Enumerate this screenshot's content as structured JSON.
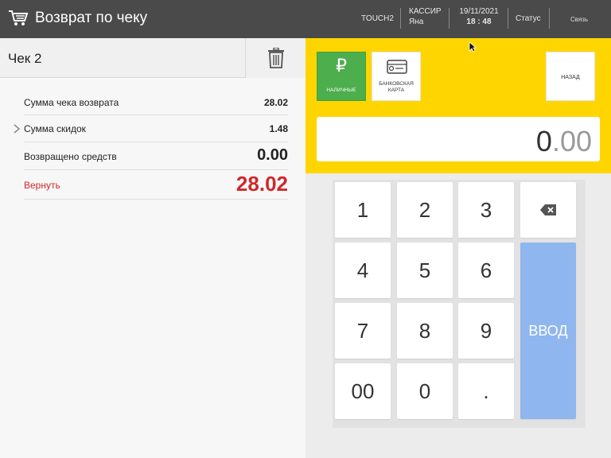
{
  "header": {
    "title": "Возврат по чеку",
    "terminal": "TOUCH2",
    "cashier_label": "КАССИР",
    "cashier_name": "Яна",
    "date": "19/11/2021",
    "time": "18 : 48",
    "status": "Статус",
    "link": "Связь"
  },
  "receipt": {
    "title": "Чек 2",
    "rows": [
      {
        "label": "Сумма чека возврата",
        "value": "28.02"
      },
      {
        "label": "Сумма скидок",
        "value": "1.48"
      },
      {
        "label": "Возвращено средств",
        "value": "0.00"
      },
      {
        "label": "Вернуть",
        "value": "28.02"
      }
    ]
  },
  "payment": {
    "cash_symbol": "₽",
    "cash_label": "НАЛИЧНЫЕ",
    "card_label_1": "БАНКОВСКАЯ",
    "card_label_2": "КАРТА",
    "back_label": "НАЗАД"
  },
  "amount": {
    "int": "0",
    "dec": ".00"
  },
  "keypad": {
    "k1": "1",
    "k2": "2",
    "k3": "3",
    "k4": "4",
    "k5": "5",
    "k6": "6",
    "k7": "7",
    "k8": "8",
    "k9": "9",
    "k00": "00",
    "k0": "0",
    "kdot": ".",
    "enter": "ВВОД"
  },
  "colors": {
    "header_bg": "#4a4a4a",
    "accent_yellow": "#ffd500",
    "cash_green": "#4cae4c",
    "enter_blue": "#8fb6ee",
    "refund_red": "#d0282a"
  }
}
